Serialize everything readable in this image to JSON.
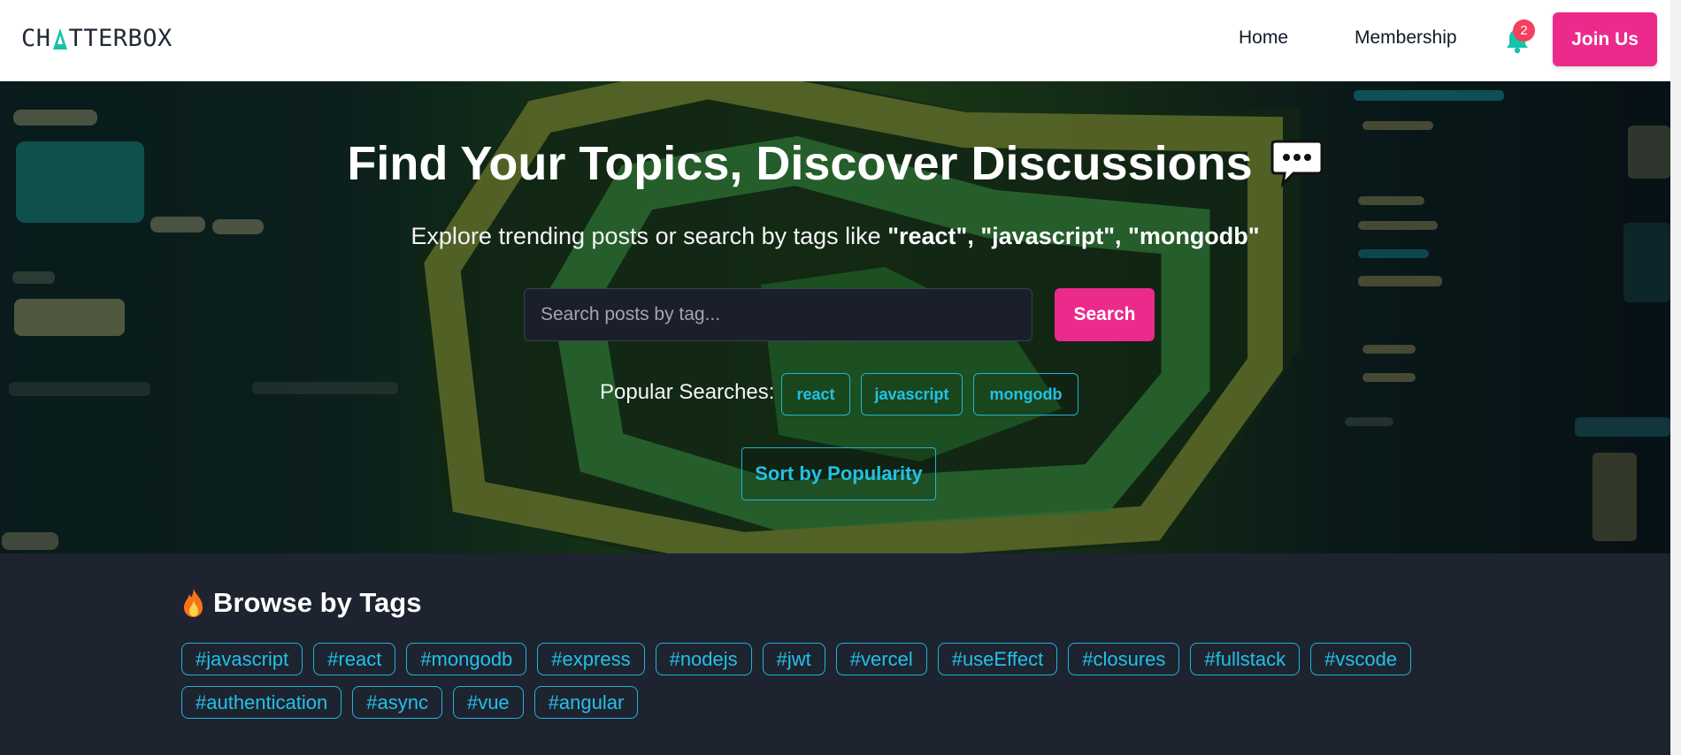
{
  "brand": {
    "logo_prefix": "CH",
    "logo_suffix": "TTERBOX",
    "accent": "#16c2a8"
  },
  "nav": {
    "home": "Home",
    "membership": "Membership",
    "notification_count": "2",
    "join_label": "Join Us",
    "join_color": "#ec2a8c",
    "bell_color": "#16c2a8"
  },
  "hero": {
    "title": "Find Your Topics, Discover Discussions",
    "title_icon": "speech-bubble-icon",
    "subtitle_prefix": "Explore trending posts or search by tags like ",
    "subtitle_tags": "\"react\", \"javascript\", \"mongodb\"",
    "search": {
      "placeholder": "Search posts by tag...",
      "button_label": "Search"
    },
    "popular_label": "Popular Searches:",
    "popular": [
      "react",
      "javascript",
      "mongodb"
    ],
    "sort_label": "Sort by Popularity"
  },
  "tags_section": {
    "heading": "Browse by Tags",
    "heading_icon": "fire-icon",
    "tags": [
      "#javascript",
      "#react",
      "#mongodb",
      "#express",
      "#nodejs",
      "#jwt",
      "#vercel",
      "#useEffect",
      "#closures",
      "#fullstack",
      "#vscode",
      "#authentication",
      "#async",
      "#vue",
      "#angular"
    ]
  }
}
